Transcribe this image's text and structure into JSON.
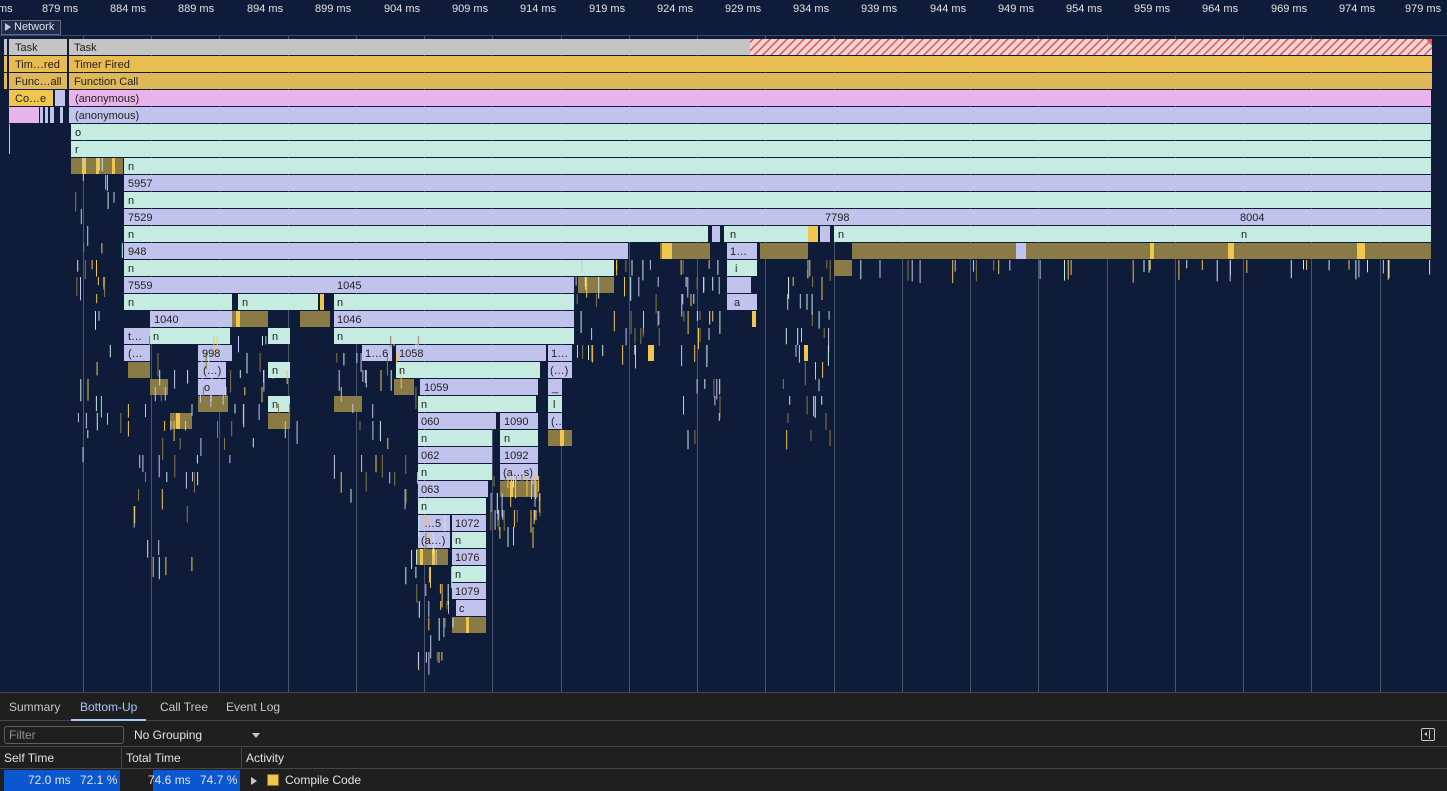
{
  "ruler": {
    "ticks": [
      "ms",
      "879 ms",
      "884 ms",
      "889 ms",
      "894 ms",
      "899 ms",
      "904 ms",
      "909 ms",
      "914 ms",
      "919 ms",
      "924 ms",
      "929 ms",
      "934 ms",
      "939 ms",
      "944 ms",
      "949 ms",
      "954 ms",
      "959 ms",
      "964 ms",
      "969 ms",
      "974 ms",
      "979 ms"
    ]
  },
  "network": {
    "label": "Network"
  },
  "colors": {
    "task": "#c4c4c4",
    "timer": "#e8bc4f",
    "function_call": "#dfb85a",
    "anonymous_pink": "#e8b4ea",
    "lavender": "#c2c3ec",
    "mint": "#c6ebe0",
    "compile": "#f0c64e",
    "compile_dark": "#8a7a45",
    "long_task_red": "#e05656",
    "background": "#0e1c3a"
  },
  "flame": {
    "labels": {
      "task_short": "Task",
      "task": "Task",
      "timer_short": "Tim…red",
      "timer": "Timer Fired",
      "func_short": "Func…all",
      "func": "Function Call",
      "compile_short": "Co…e",
      "anon1": "(anonymous)",
      "anon2": "(anonymous)",
      "o": "o",
      "r": "r",
      "n1": "n",
      "v5957": "5957",
      "n2": "n",
      "v7529": "7529",
      "v7798": "7798",
      "v8004": "8004",
      "n3": "n",
      "n3b": "n",
      "n3c": "n",
      "n3d": "n",
      "v948": "948",
      "d1": "1…",
      "n4": "n",
      "i": "i",
      "v7559": "7559",
      "v1045": "1045",
      "n5": "n",
      "n5b": "n",
      "n5c": "n",
      "a": "a",
      "v1040": "1040",
      "v1046": "1046",
      "t": "t…",
      "n6": "n",
      "n6b": "n",
      "n6c": "n",
      "p1": "(…",
      "v998": "998",
      "d16": "1…6",
      "v1058": "1058",
      "d1b": "1…",
      "e1": "(…)",
      "n7": "n",
      "n7b": "n",
      "e2": "(…)",
      "o2": "o",
      "v1059": "1059",
      "us": "_",
      "n8": "n",
      "n8b": "n",
      "l": "l",
      "v060": "060",
      "v1090": "1090",
      "e3": "(…",
      "n9": "n",
      "n9b": "n",
      "v062": "062",
      "v1092": "1092",
      "n10": "n",
      "as": "(a…s)",
      "v063": "063",
      "n11": "n",
      "d5": "…5",
      "v1072": "1072",
      "ae": "(a…)",
      "n12": "n",
      "v1076": "1076",
      "n13": "n",
      "v1079": "1079",
      "c": "c"
    }
  },
  "bottom": {
    "tabs": [
      "Summary",
      "Bottom-Up",
      "Call Tree",
      "Event Log"
    ],
    "active_tab": "Bottom-Up",
    "filter_placeholder": "Filter",
    "grouping": "No Grouping",
    "columns": {
      "self": "Self Time",
      "total": "Total Time",
      "activity": "Activity"
    },
    "rows": [
      {
        "self_ms": "72.0 ms",
        "self_pct": "72.1 %",
        "total_ms": "74.6 ms",
        "total_pct": "74.7 %",
        "activity": "Compile Code",
        "color": "#f0c64e"
      }
    ]
  }
}
